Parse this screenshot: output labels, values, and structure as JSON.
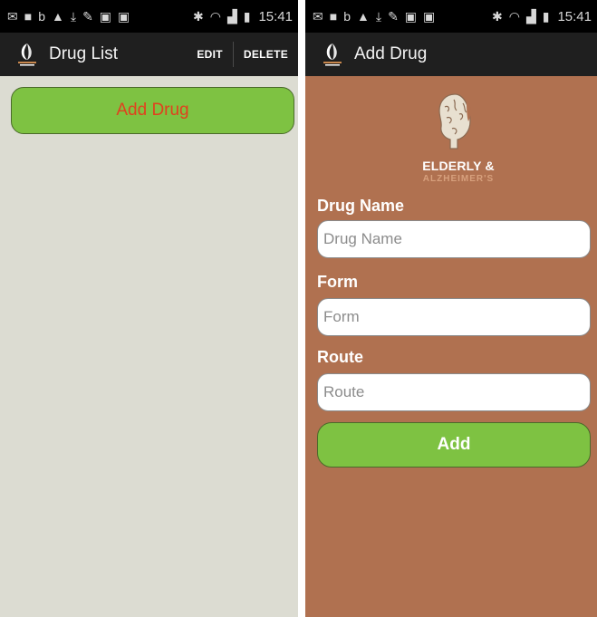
{
  "status_bar": {
    "time": "15:41"
  },
  "icons": {
    "status_left": [
      "mail-icon",
      "video-icon",
      "beats-icon",
      "warning-icon",
      "download-icon",
      "pen-icon",
      "image-icon",
      "image-icon"
    ],
    "status_right": [
      "bluetooth-icon",
      "wifi-icon",
      "signal-icon",
      "battery-icon"
    ]
  },
  "colors": {
    "green_button": "#7ec242",
    "add_drug_label": "#e0411e",
    "form_background": "#b07150",
    "list_background": "#dcdcd2"
  },
  "drug_list": {
    "title": "Drug List",
    "edit_label": "EDIT",
    "delete_label": "DELETE",
    "add_drug_label": "Add Drug"
  },
  "add_drug": {
    "title": "Add Drug",
    "brand_name": "ELDERLY &",
    "brand_sub": "ALZHEIMER'S",
    "fields": [
      {
        "label": "Drug Name",
        "value": "",
        "placeholder": "Drug Name"
      },
      {
        "label": "Form",
        "value": "",
        "placeholder": "Form"
      },
      {
        "label": "Route",
        "value": "",
        "placeholder": "Route"
      }
    ],
    "add_label": "Add"
  }
}
